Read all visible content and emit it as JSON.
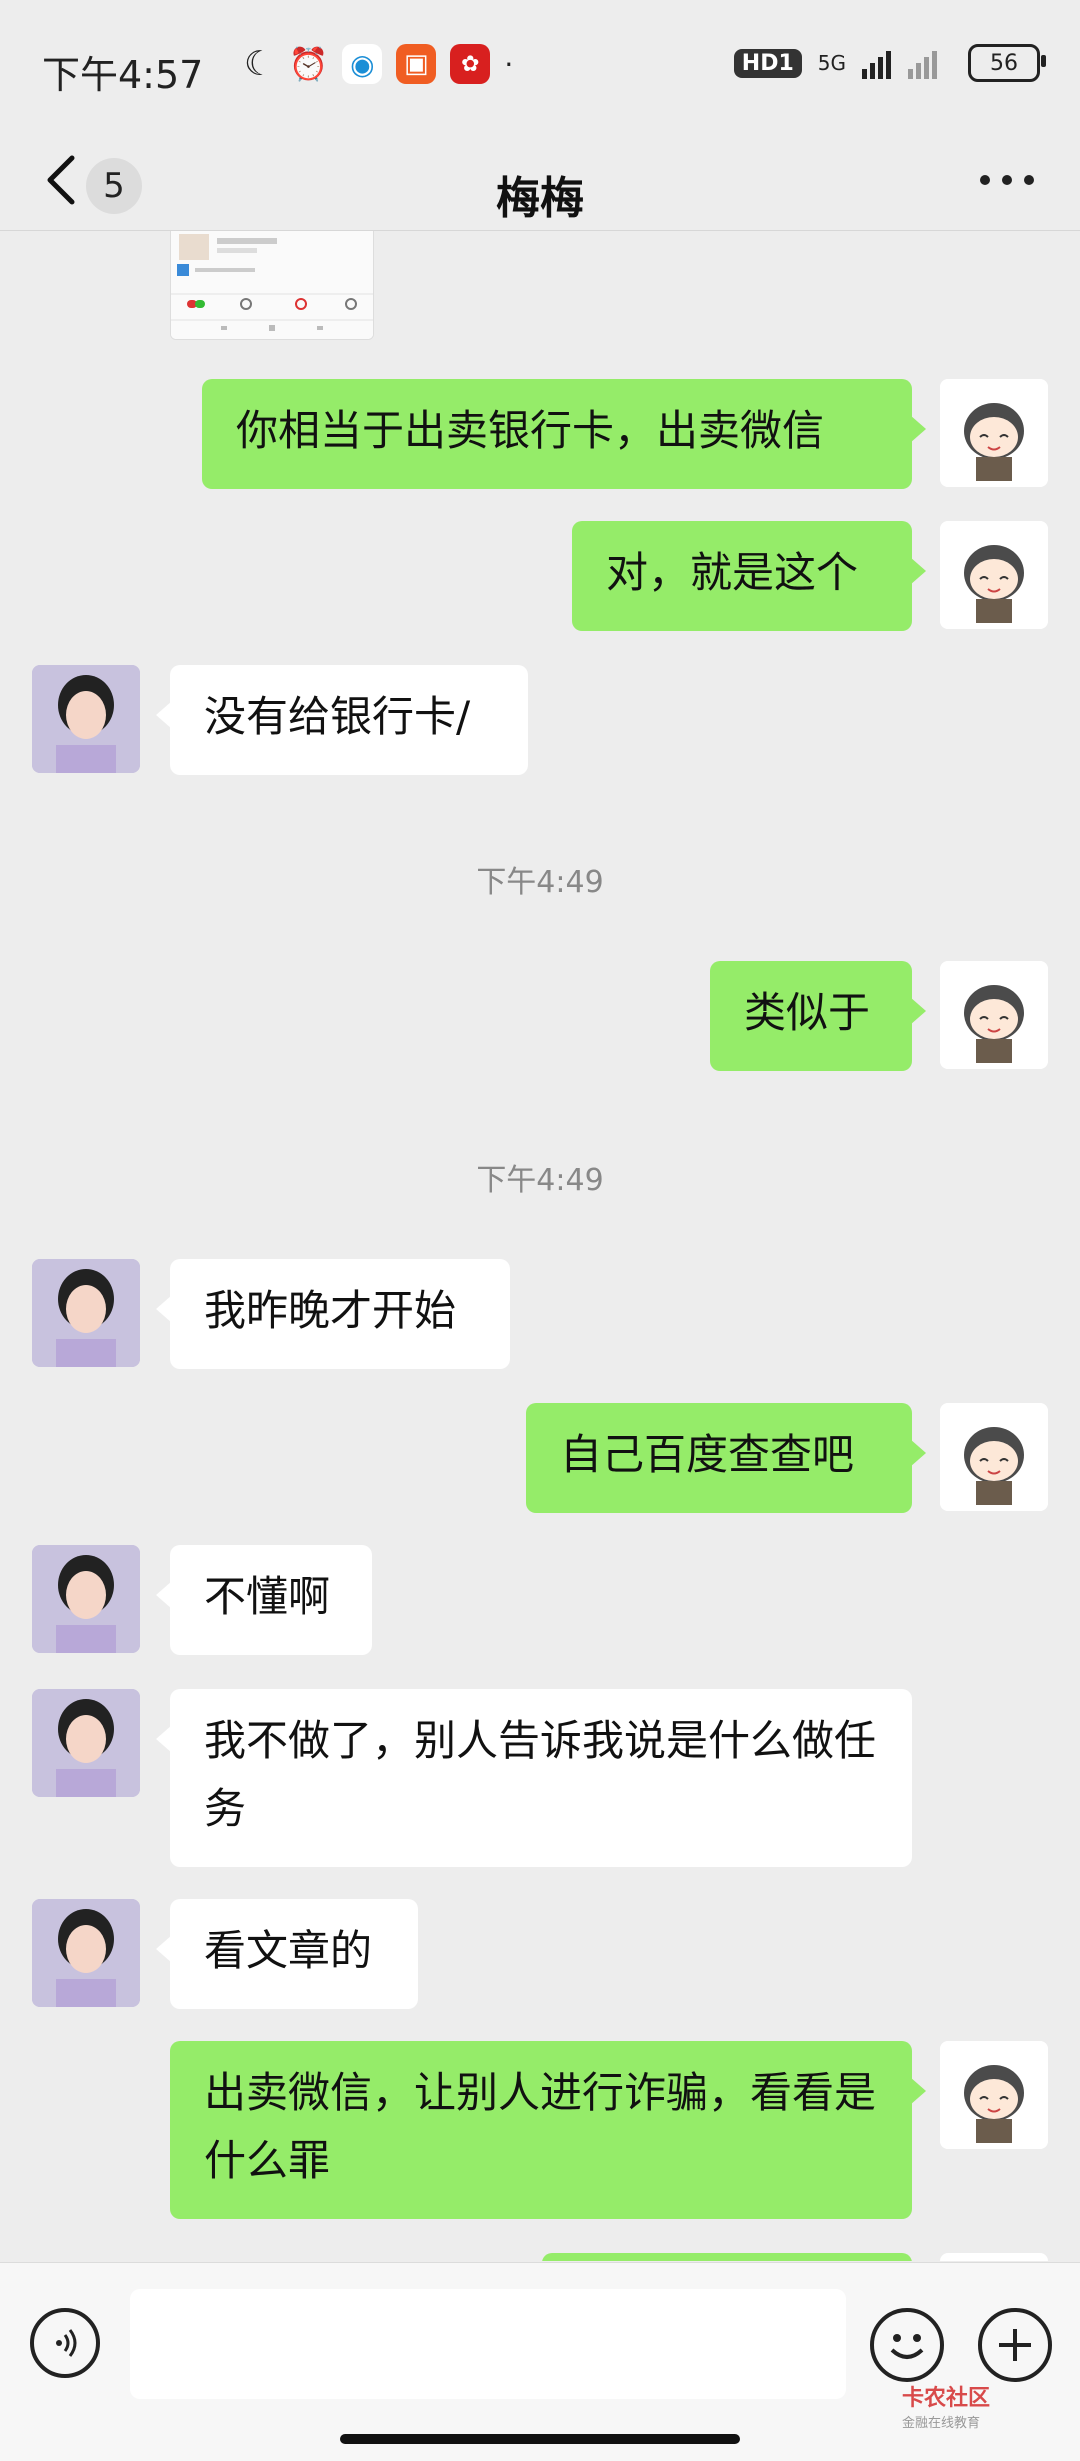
{
  "status_bar": {
    "time": "下午4:57",
    "network": "5G",
    "hd": "HD1",
    "battery": "56"
  },
  "header": {
    "title": "梅梅",
    "back_count": "5"
  },
  "messages": [
    {
      "type": "sent",
      "text": "你相当于出卖银行卡，出卖微信"
    },
    {
      "type": "sent",
      "text": "对，就是这个"
    },
    {
      "type": "received",
      "text": "没有给银行卡/"
    },
    {
      "type": "time",
      "text": "下午4:49"
    },
    {
      "type": "sent",
      "text": "类似于"
    },
    {
      "type": "time",
      "text": "下午4:49"
    },
    {
      "type": "received",
      "text": "我昨晚才开始"
    },
    {
      "type": "sent",
      "text": "自己百度查查吧"
    },
    {
      "type": "received",
      "text": "不懂啊"
    },
    {
      "type": "received",
      "text": "我不做了，别人告诉我说是什么做任务"
    },
    {
      "type": "received",
      "text": "看文章的"
    },
    {
      "type": "sent",
      "text": "出卖微信，让别人进行诈骗，看看是什么罪"
    }
  ],
  "watermark": {
    "title": "卡农社区",
    "subtitle": "金融在线教育"
  },
  "colors": {
    "sent_bubble": "#95ec69",
    "received_bubble": "#ffffff",
    "background": "#ededed"
  }
}
